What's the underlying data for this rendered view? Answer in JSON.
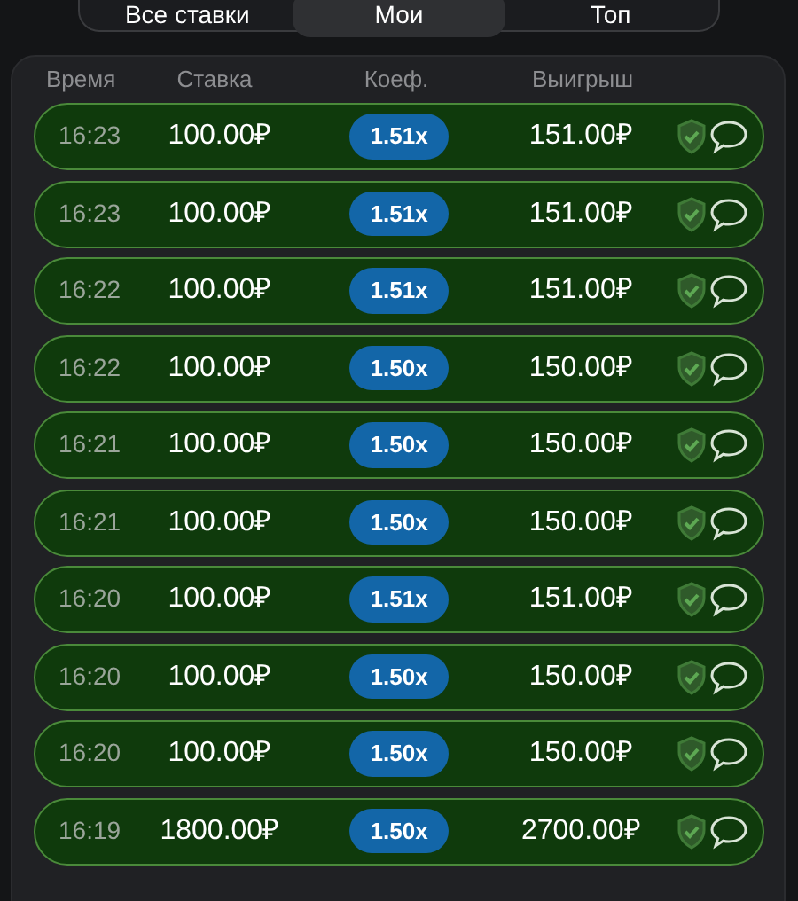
{
  "tabs": [
    {
      "label": "Все ставки",
      "selected": false
    },
    {
      "label": "Мои",
      "selected": true
    },
    {
      "label": "Топ",
      "selected": false
    }
  ],
  "columns": [
    "Время",
    "Ставка",
    "Коеф.",
    "Выигрыш"
  ],
  "rows": [
    {
      "time": "16:23",
      "bet": "100.00₽",
      "coef": "1.51x",
      "win": "151.00₽"
    },
    {
      "time": "16:23",
      "bet": "100.00₽",
      "coef": "1.51x",
      "win": "151.00₽"
    },
    {
      "time": "16:22",
      "bet": "100.00₽",
      "coef": "1.51x",
      "win": "151.00₽"
    },
    {
      "time": "16:22",
      "bet": "100.00₽",
      "coef": "1.50x",
      "win": "150.00₽"
    },
    {
      "time": "16:21",
      "bet": "100.00₽",
      "coef": "1.50x",
      "win": "150.00₽"
    },
    {
      "time": "16:21",
      "bet": "100.00₽",
      "coef": "1.50x",
      "win": "150.00₽"
    },
    {
      "time": "16:20",
      "bet": "100.00₽",
      "coef": "1.51x",
      "win": "151.00₽"
    },
    {
      "time": "16:20",
      "bet": "100.00₽",
      "coef": "1.50x",
      "win": "150.00₽"
    },
    {
      "time": "16:20",
      "bet": "100.00₽",
      "coef": "1.50x",
      "win": "150.00₽"
    },
    {
      "time": "16:19",
      "bet": "1800.00₽",
      "coef": "1.50x",
      "win": "2700.00₽"
    }
  ]
}
